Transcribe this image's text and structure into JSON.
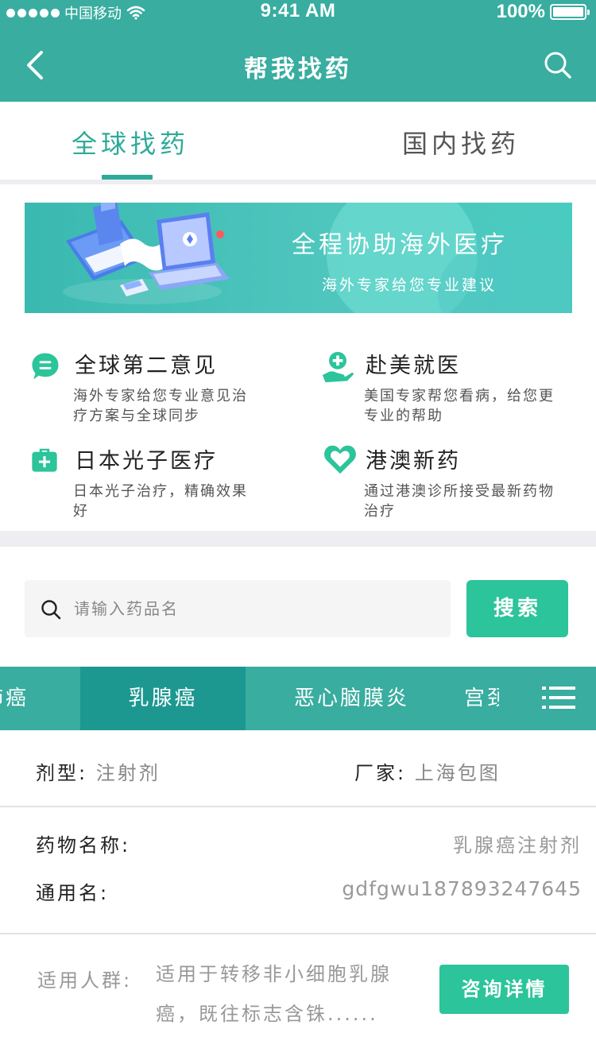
{
  "status": {
    "carrier": "中国移动",
    "time": "9:41 AM",
    "battery": "100%"
  },
  "nav": {
    "title": "帮我找药"
  },
  "tabs": [
    {
      "label": "全球找药",
      "active": true
    },
    {
      "label": "国内找药",
      "active": false
    }
  ],
  "banner": {
    "title": "全程协助海外医疗",
    "subtitle": "海外专家给您专业建议"
  },
  "services": [
    {
      "title": "全球第二意见",
      "desc": "海外专家给您专业意见治疗方案与全球同步",
      "icon": "chat-icon"
    },
    {
      "title": "赴美就医",
      "desc": "美国专家帮您看病，给您更专业的帮助",
      "icon": "hand-plus-icon"
    },
    {
      "title": "日本光子医疗",
      "desc": "日本光子治疗，精确效果好",
      "icon": "medkit-icon"
    },
    {
      "title": "港澳新药",
      "desc": "通过港澳诊所接受最新药物治疗",
      "icon": "heart-icon"
    }
  ],
  "search": {
    "placeholder": "请输入药品名",
    "button": "搜索"
  },
  "categories": [
    "肺癌",
    "乳腺癌",
    "恶心脑膜炎",
    "宫颈"
  ],
  "drug": {
    "form_label": "剂型:",
    "form_value": "注射剂",
    "maker_label": "厂家:",
    "maker_value": "上海包图",
    "name_label": "药物名称:",
    "name_value": "乳腺癌注射剂",
    "generic_label": "通用名:",
    "generic_value": "gdfgwu187893247645",
    "audience_label": "适用人群:",
    "audience_value": "适用于转移非小细胞乳腺癌，既往标志含铢......",
    "consult_button": "咨询详情"
  },
  "colors": {
    "primary": "#38ada0",
    "accent": "#2cc49a",
    "tab_active": "#2eaa98",
    "selected_category": "#1d9891"
  }
}
